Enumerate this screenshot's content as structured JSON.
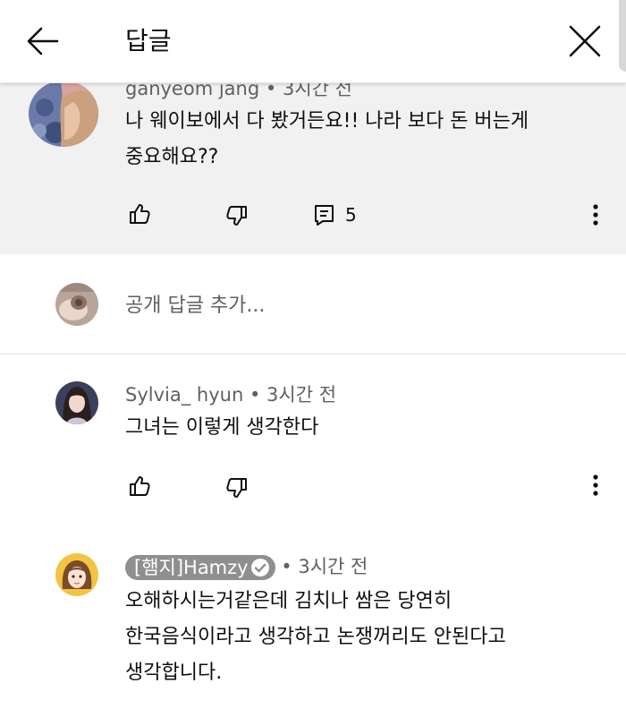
{
  "header": {
    "title": "답글",
    "back_icon": "arrow-back-icon",
    "close_icon": "close-icon"
  },
  "parent_comment": {
    "author": "ganyeom jang",
    "time": "3시간 전",
    "text_line1": "나 웨이보에서 다 봤거든요!! 나라 보다 돈 버는게",
    "text_line2": "중요해요??",
    "reply_count": "5"
  },
  "add_reply": {
    "placeholder": "공개 답글 추가..."
  },
  "replies": [
    {
      "author": "Sylvia_ hyun",
      "time": "3시간 전",
      "text": "그녀는 이렇게 생각한다"
    },
    {
      "author": "[햄지]Hamzy",
      "verified": true,
      "time": "3시간 전",
      "text_line1": "오해하시는거같은데 김치나 쌈은 당연히",
      "text_line2": "한국음식이라고 생각하고 논쟁꺼리도 안된다고",
      "text_line3": "생각합니다."
    }
  ],
  "separator": "•",
  "colors": {
    "header_bg": "#ffffff",
    "highlight_bg": "#f1f1f1",
    "meta_text": "#606060",
    "badge_bg": "#8f8f8f"
  }
}
